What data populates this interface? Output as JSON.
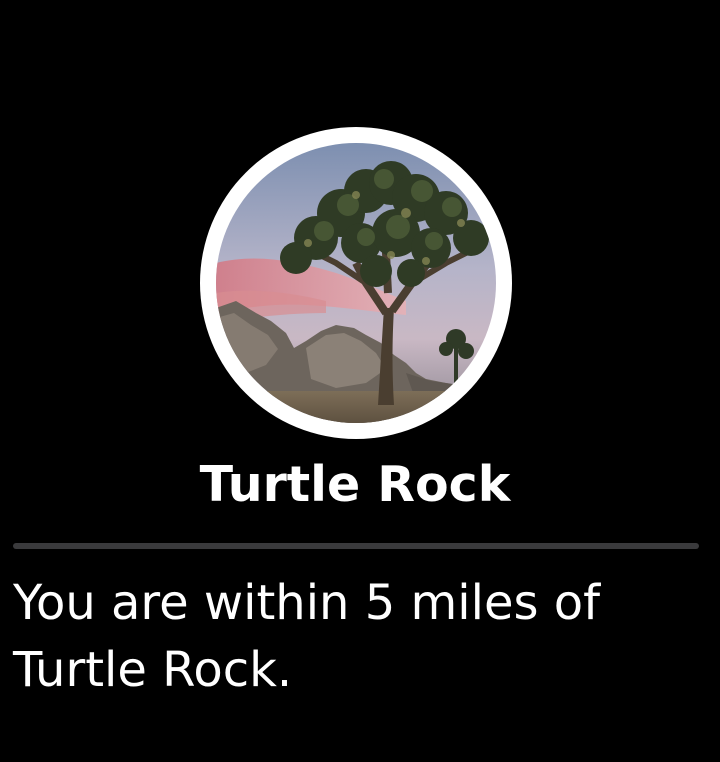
{
  "landmark": {
    "name": "Turtle Rock",
    "image_icon": "joshua-tree-landscape-photo"
  },
  "notification": {
    "message": "You are within 5 miles of Turtle Rock."
  },
  "colors": {
    "background": "#000000",
    "text": "#ffffff",
    "divider": "#3a3a3c",
    "ring": "#ffffff"
  }
}
